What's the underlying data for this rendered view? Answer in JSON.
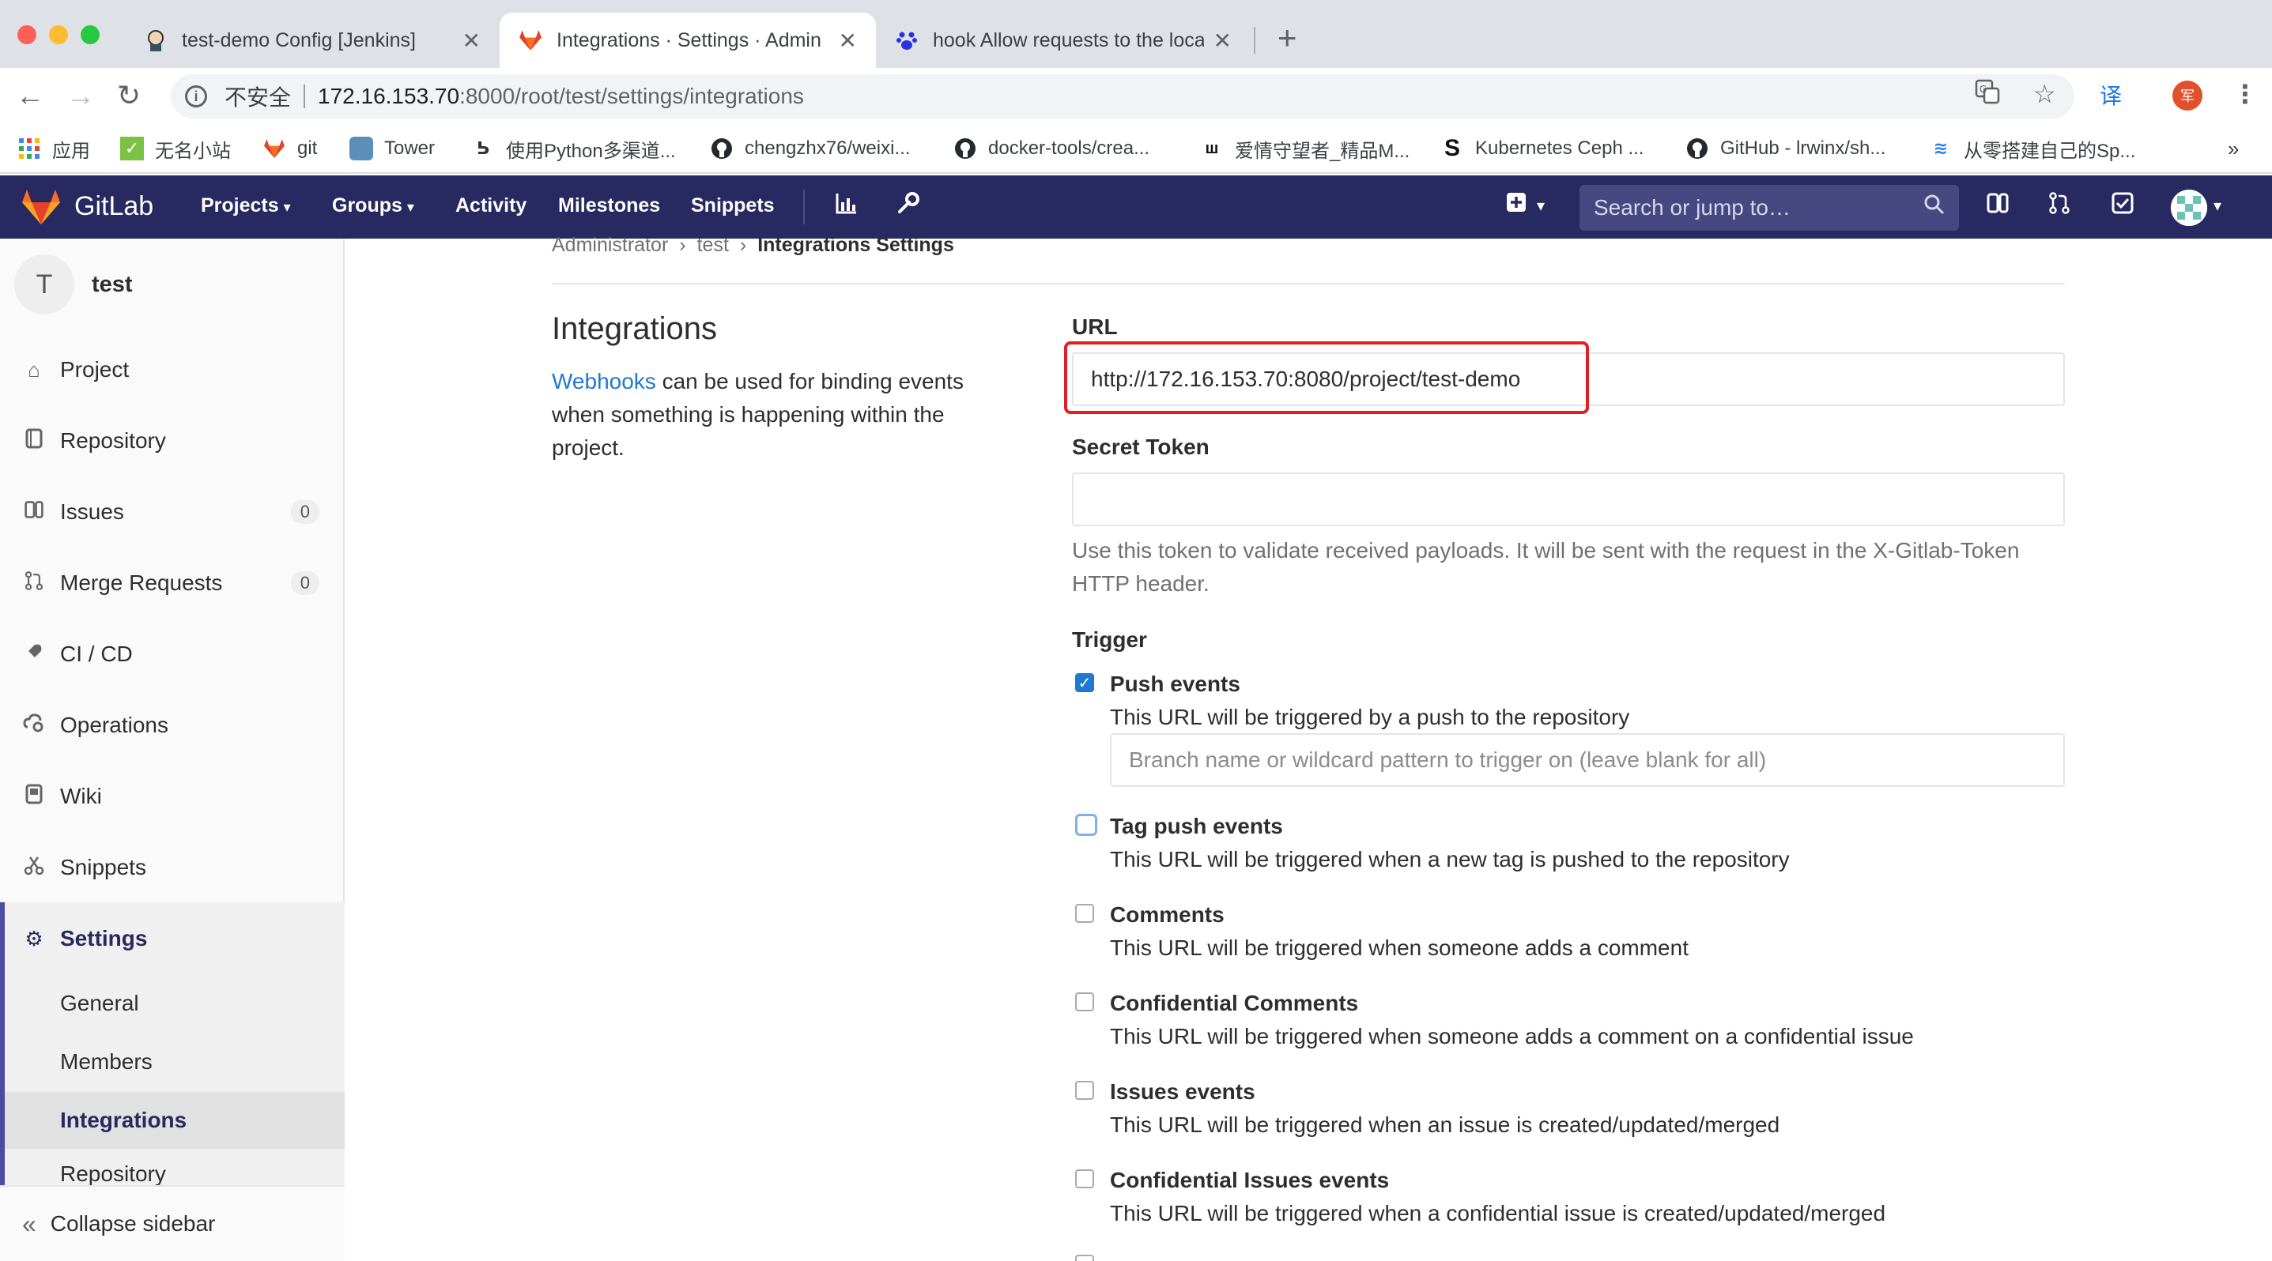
{
  "browser": {
    "tabs": [
      {
        "title": "test-demo Config [Jenkins]",
        "icon": "jenkins-icon"
      },
      {
        "title": "Integrations · Settings · Admin",
        "icon": "gitlab-icon"
      },
      {
        "title": "hook Allow requests to the loca",
        "icon": "baidu-paw-icon"
      }
    ],
    "address": {
      "security_label": "不安全",
      "host": "172.16.153.70",
      "rest": ":8000/root/test/settings/integrations"
    },
    "bookmarks": [
      "应用",
      "无名小站",
      "git",
      "Tower",
      "使用Python多渠道...",
      "chengzhx76/weixi...",
      "docker-tools/crea...",
      "爱情守望者_精品M...",
      "Kubernetes Ceph ...",
      "GitHub - lrwinx/sh...",
      "从零搭建自己的Sp..."
    ],
    "bookmarks_more": "»",
    "translate_label": "译",
    "profile_letter": "军"
  },
  "gitlab_header": {
    "brand": "GitLab",
    "nav": [
      "Projects",
      "Groups",
      "Activity",
      "Milestones",
      "Snippets"
    ],
    "search_placeholder": "Search or jump to…",
    "colors": {
      "header_bg": "#292961",
      "accent": "#1f78d1"
    }
  },
  "sidebar": {
    "project_initial": "T",
    "project_name": "test",
    "items": [
      {
        "label": "Project",
        "icon": "home-icon"
      },
      {
        "label": "Repository",
        "icon": "book-icon"
      },
      {
        "label": "Issues",
        "icon": "issues-icon",
        "count": "0"
      },
      {
        "label": "Merge Requests",
        "icon": "merge-request-icon",
        "count": "0"
      },
      {
        "label": "CI / CD",
        "icon": "rocket-icon"
      },
      {
        "label": "Operations",
        "icon": "cloud-gear-icon"
      },
      {
        "label": "Wiki",
        "icon": "wiki-icon"
      },
      {
        "label": "Snippets",
        "icon": "scissors-icon"
      }
    ],
    "settings_label": "Settings",
    "settings_sub": [
      "General",
      "Members",
      "Integrations",
      "Repository"
    ],
    "collapse_label": "Collapse sidebar"
  },
  "breadcrumb": [
    "Administrator",
    "test",
    "Integrations Settings"
  ],
  "section": {
    "title": "Integrations",
    "link_text": "Webhooks",
    "desc_rest": " can be used for binding events when something is happening within the project."
  },
  "form": {
    "url_label": "URL",
    "url_value": "http://172.16.153.70:8080/project/test-demo",
    "token_label": "Secret Token",
    "token_value": "",
    "token_help": "Use this token to validate received payloads. It will be sent with the request in the X-Gitlab-Token HTTP header.",
    "trigger_label": "Trigger",
    "branch_placeholder": "Branch name or wildcard pattern to trigger on (leave blank for all)",
    "triggers": [
      {
        "title": "Push events",
        "desc": "This URL will be triggered by a push to the repository",
        "checked": true
      },
      {
        "title": "Tag push events",
        "desc": "This URL will be triggered when a new tag is pushed to the repository",
        "checked": false
      },
      {
        "title": "Comments",
        "desc": "This URL will be triggered when someone adds a comment",
        "checked": false
      },
      {
        "title": "Confidential Comments",
        "desc": "This URL will be triggered when someone adds a comment on a confidential issue",
        "checked": false
      },
      {
        "title": "Issues events",
        "desc": "This URL will be triggered when an issue is created/updated/merged",
        "checked": false
      },
      {
        "title": "Confidential Issues events",
        "desc": "This URL will be triggered when a confidential issue is created/updated/merged",
        "checked": false
      }
    ]
  }
}
